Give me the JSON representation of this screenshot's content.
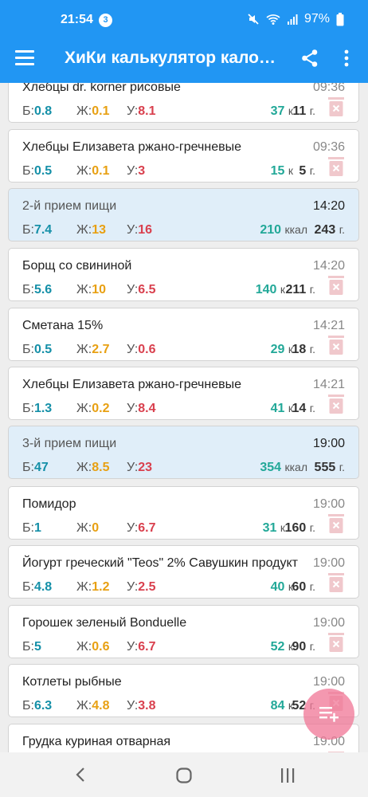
{
  "status": {
    "time": "21:54",
    "badge": "3",
    "battery": "97%"
  },
  "app": {
    "title": "ХиКи калькулятор калорий"
  },
  "labels": {
    "protein": "Б:",
    "fat": "Ж:",
    "carbs": "У:",
    "kcal_short": "к",
    "kcal_full": "ккал",
    "grams": "г."
  },
  "colors": {
    "accent": "#2196f3",
    "protein": "#1590a8",
    "fat": "#e8a012",
    "carbs": "#d9404e",
    "kcal": "#22a898",
    "delete_icon": "#f0c8cc",
    "fab": "#f07696"
  },
  "entries": [
    {
      "type": "food",
      "name": "Хлебцы dr. korner рисовые",
      "time": "09:36",
      "p": "0.8",
      "f": "0.1",
      "c": "8.1",
      "kcal": "37",
      "kcal_unit": "к",
      "grams": "11"
    },
    {
      "type": "food",
      "name": "Хлебцы Елизавета ржано-гречневые",
      "time": "09:36",
      "p": "0.5",
      "f": "0.1",
      "c": "3",
      "kcal": "15",
      "kcal_unit": "к",
      "grams": "5"
    },
    {
      "type": "meal",
      "name": "2-й прием пищи",
      "time": "14:20",
      "p": "7.4",
      "f": "13",
      "c": "16",
      "kcal": "210",
      "kcal_unit": "ккал",
      "grams": "243"
    },
    {
      "type": "food",
      "name": "Борщ со свининой",
      "time": "14:20",
      "p": "5.6",
      "f": "10",
      "c": "6.5",
      "kcal": "140",
      "kcal_unit": "к",
      "grams": "211"
    },
    {
      "type": "food",
      "name": "Сметана 15%",
      "time": "14:21",
      "p": "0.5",
      "f": "2.7",
      "c": "0.6",
      "kcal": "29",
      "kcal_unit": "к",
      "grams": "18"
    },
    {
      "type": "food",
      "name": "Хлебцы Елизавета ржано-гречневые",
      "time": "14:21",
      "p": "1.3",
      "f": "0.2",
      "c": "8.4",
      "kcal": "41",
      "kcal_unit": "к",
      "grams": "14"
    },
    {
      "type": "meal",
      "name": "3-й прием пищи",
      "time": "19:00",
      "p": "47",
      "f": "8.5",
      "c": "23",
      "kcal": "354",
      "kcal_unit": "ккал",
      "grams": "555"
    },
    {
      "type": "food",
      "name": "Помидор",
      "time": "19:00",
      "p": "1",
      "f": "0",
      "c": "6.7",
      "kcal": "31",
      "kcal_unit": "к",
      "grams": "160"
    },
    {
      "type": "food",
      "name": "Йогурт греческий \"Teos\" 2% Савушкин продукт",
      "time": "19:00",
      "p": "4.8",
      "f": "1.2",
      "c": "2.5",
      "kcal": "40",
      "kcal_unit": "к",
      "grams": "60"
    },
    {
      "type": "food",
      "name": "Горошек зеленый Bonduelle",
      "time": "19:00",
      "p": "5",
      "f": "0.6",
      "c": "6.7",
      "kcal": "52",
      "kcal_unit": "к",
      "grams": "90"
    },
    {
      "type": "food",
      "name": "Котлеты рыбные",
      "time": "19:00",
      "p": "6.3",
      "f": "4.8",
      "c": "3.8",
      "kcal": "84",
      "kcal_unit": "к",
      "grams": "52"
    },
    {
      "type": "food",
      "name": "Грудка куриная отварная",
      "time": "19:00",
      "p": "",
      "f": "",
      "c": "",
      "kcal": "",
      "kcal_unit": "",
      "grams": ""
    }
  ],
  "icons": {
    "menu": "hamburger-menu-icon",
    "share": "share-icon",
    "more": "more-vert-icon",
    "delete": "trash-icon",
    "fab": "add-to-list-icon",
    "back": "back-icon",
    "home": "home-icon",
    "recent": "recent-apps-icon"
  }
}
